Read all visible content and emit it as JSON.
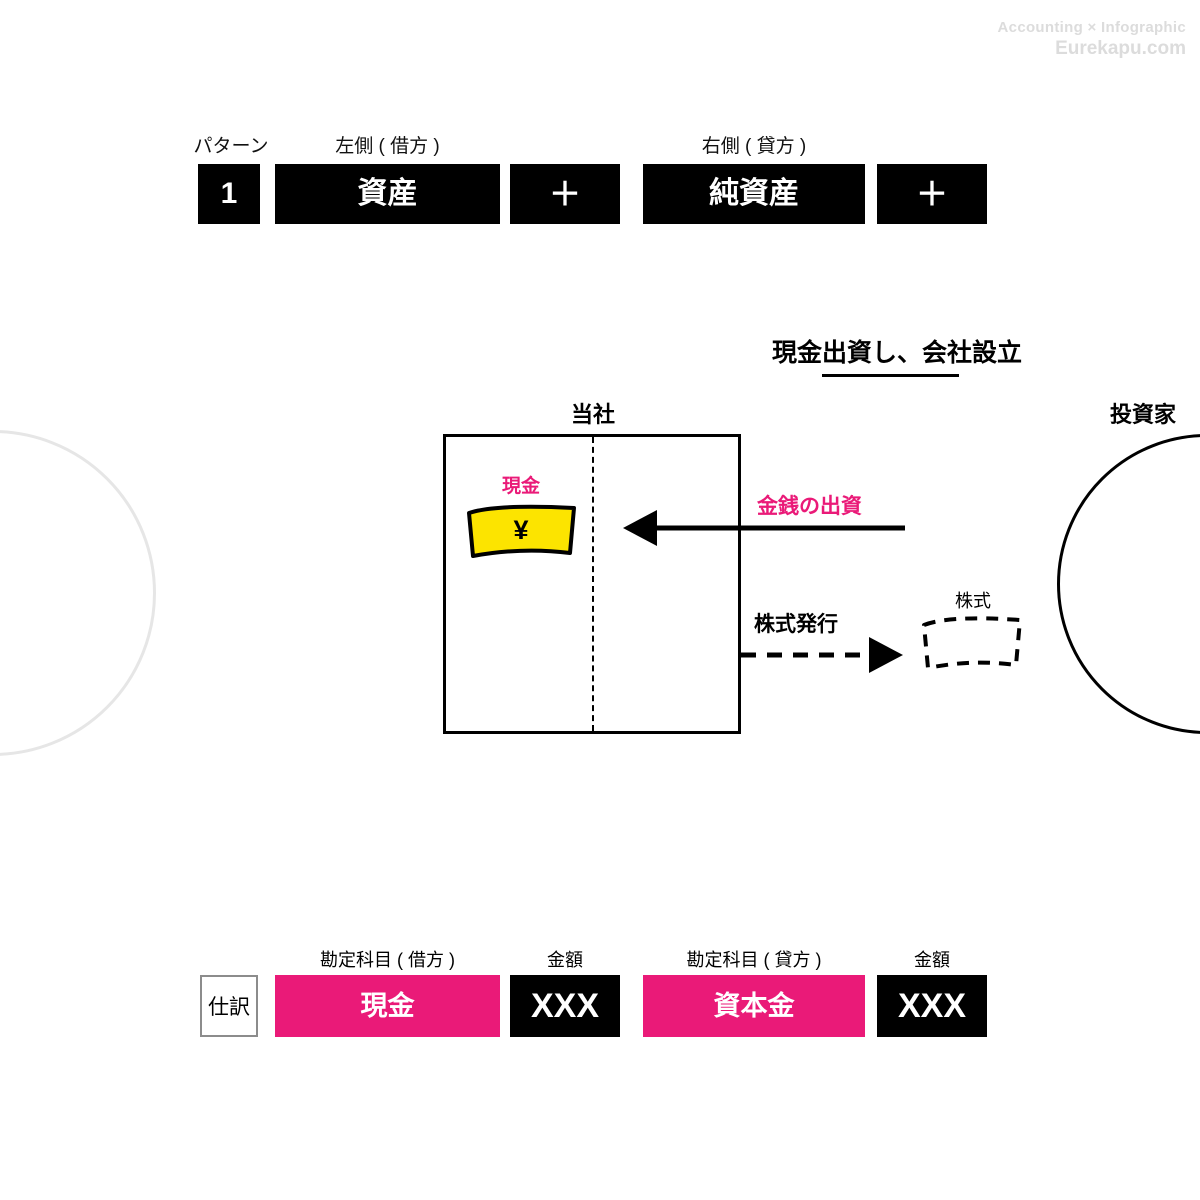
{
  "watermark": {
    "line1": "Accounting × Infographic",
    "line2": "Eurekapu.com"
  },
  "pattern_row": {
    "pattern_label": "パターン",
    "pattern_number": "1",
    "debit_header": "左側 ( 借方 )",
    "debit_item": "資産",
    "debit_sign": "＋",
    "credit_header": "右側 ( 貸方 )",
    "credit_item": "純資産",
    "credit_sign": "＋"
  },
  "diagram": {
    "title": "現金出資し、会社設立",
    "company_label": "当社",
    "investor_label": "投資家",
    "cash_label": "現金",
    "cash_symbol": "¥",
    "stock_label": "株式",
    "arrow_money_label": "金銭の出資",
    "arrow_stock_label": "株式発行"
  },
  "journal_entry": {
    "row_label": "仕訳",
    "debit_account_header": "勘定科目 ( 借方 )",
    "debit_amount_header": "金額",
    "credit_account_header": "勘定科目 ( 貸方 )",
    "credit_amount_header": "金額",
    "debit_account": "現金",
    "debit_amount": "XXX",
    "credit_account": "資本金",
    "credit_amount": "XXX"
  },
  "colors": {
    "accent_pink": "#ea1a78",
    "black": "#000000",
    "note_yellow": "#fce400",
    "watermark_gray": "#dcdcdc",
    "deco_gray": "#e6e6e6"
  }
}
